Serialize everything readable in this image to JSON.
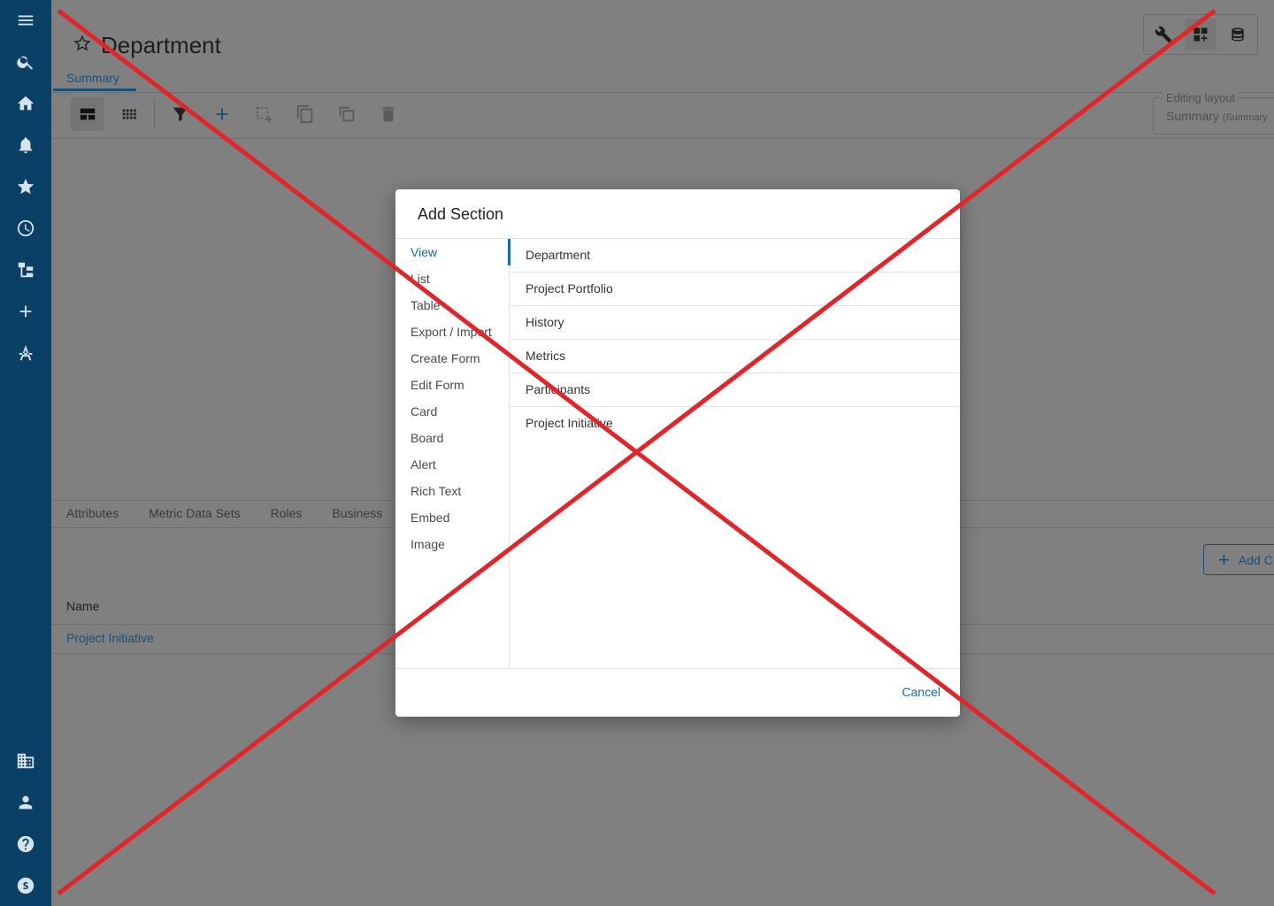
{
  "nav": {
    "items": [
      {
        "name": "menu-icon"
      },
      {
        "name": "search-icon"
      },
      {
        "name": "home-icon"
      },
      {
        "name": "bell-icon"
      },
      {
        "name": "star-icon"
      },
      {
        "name": "clock-icon"
      },
      {
        "name": "hierarchy-icon"
      },
      {
        "name": "plus-icon"
      },
      {
        "name": "compass-icon"
      }
    ],
    "bottom_items": [
      {
        "name": "building-icon"
      },
      {
        "name": "user-icon"
      },
      {
        "name": "help-icon"
      },
      {
        "name": "app-logo-icon"
      }
    ],
    "color": "#0a3f66"
  },
  "page": {
    "title": "Department",
    "tab": "Summary"
  },
  "layout_editor": {
    "legend": "Editing layout",
    "value": "Summary",
    "value_hint": "(Summary"
  },
  "bottom_tabs": [
    "Attributes",
    "Metric Data Sets",
    "Roles",
    "Business"
  ],
  "add_button": {
    "label": "Add C"
  },
  "table": {
    "column": "Name",
    "rows": [
      "Project Initiative"
    ]
  },
  "modal": {
    "title": "Add Section",
    "categories": [
      "View",
      "List",
      "Table",
      "Export / Import",
      "Create Form",
      "Edit Form",
      "Card",
      "Board",
      "Alert",
      "Rich Text",
      "Embed",
      "Image"
    ],
    "selected_category": "View",
    "options": [
      "Department",
      "Project Portfolio",
      "History",
      "Metrics",
      "Participants",
      "Project Initiative"
    ],
    "cancel": "Cancel"
  },
  "colors": {
    "accent": "#1a6aa6",
    "overlay_x": "#e0262b"
  }
}
